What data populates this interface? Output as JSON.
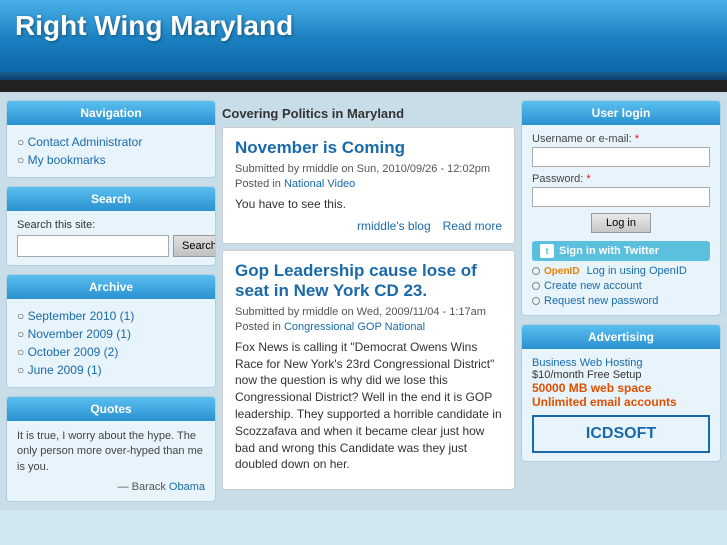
{
  "header": {
    "title": "Right Wing Maryland"
  },
  "left_sidebar": {
    "navigation": {
      "title": "Navigation",
      "links": [
        {
          "label": "Contact Administrator",
          "href": "#"
        },
        {
          "label": "My bookmarks",
          "href": "#"
        }
      ]
    },
    "search": {
      "title": "Search",
      "label": "Search this site:",
      "placeholder": "",
      "button_label": "Search"
    },
    "archive": {
      "title": "Archive",
      "items": [
        {
          "label": "September 2010 (1)",
          "href": "#"
        },
        {
          "label": "November 2009 (1)",
          "href": "#"
        },
        {
          "label": "October 2009 (2)",
          "href": "#"
        },
        {
          "label": "June 2009 (1)",
          "href": "#"
        }
      ]
    },
    "quotes": {
      "title": "Quotes",
      "text": "It is true, I worry about the hype. The only person more over-hyped than me is you.",
      "author": "— Barack",
      "author_link": "Obama"
    }
  },
  "main": {
    "header": "Covering Politics in Maryland",
    "articles": [
      {
        "title": "November is Coming",
        "meta_submitted": "Submitted by rmiddle on Sun, 2010/09/26 - 12:02pm",
        "meta_posted": "Posted in",
        "categories": [
          "National",
          "Video"
        ],
        "body": "You have to see this.",
        "blog_link": "rmiddle's blog",
        "read_more": "Read more"
      },
      {
        "title": "Gop Leadership cause lose of seat in New York CD 23.",
        "meta_submitted": "Submitted by rmiddle on Wed, 2009/11/04 - 1:17am",
        "meta_posted": "Posted in",
        "categories": [
          "Congressional",
          "GOP",
          "National"
        ],
        "body": "Fox News is calling it \"Democrat Owens Wins Race for New York's 23rd Congressional District\" now the question is why did we lose this Congressional District? Well in the end it is GOP leadership. They supported a horrible candidate in Scozzafava and when it became clear just how bad and wrong this Candidate was they just doubled down on her."
      }
    ]
  },
  "right_sidebar": {
    "user_login": {
      "title": "User login",
      "username_label": "Username or e-mail:",
      "username_required": "*",
      "password_label": "Password:",
      "password_required": "*",
      "login_button": "Log in",
      "twitter_button": "Sign in with Twitter",
      "openid_label": "Log in using OpenID",
      "create_account": "Create new account",
      "request_password": "Request new password"
    },
    "advertising": {
      "title": "Advertising",
      "hosting_label": "Business Web Hosting",
      "price_line": "$10/month Free Setup",
      "highlight1": "50000 MB web space",
      "highlight2": "Unlimited email accounts",
      "ad_box_text": "ICDSOFT"
    }
  }
}
